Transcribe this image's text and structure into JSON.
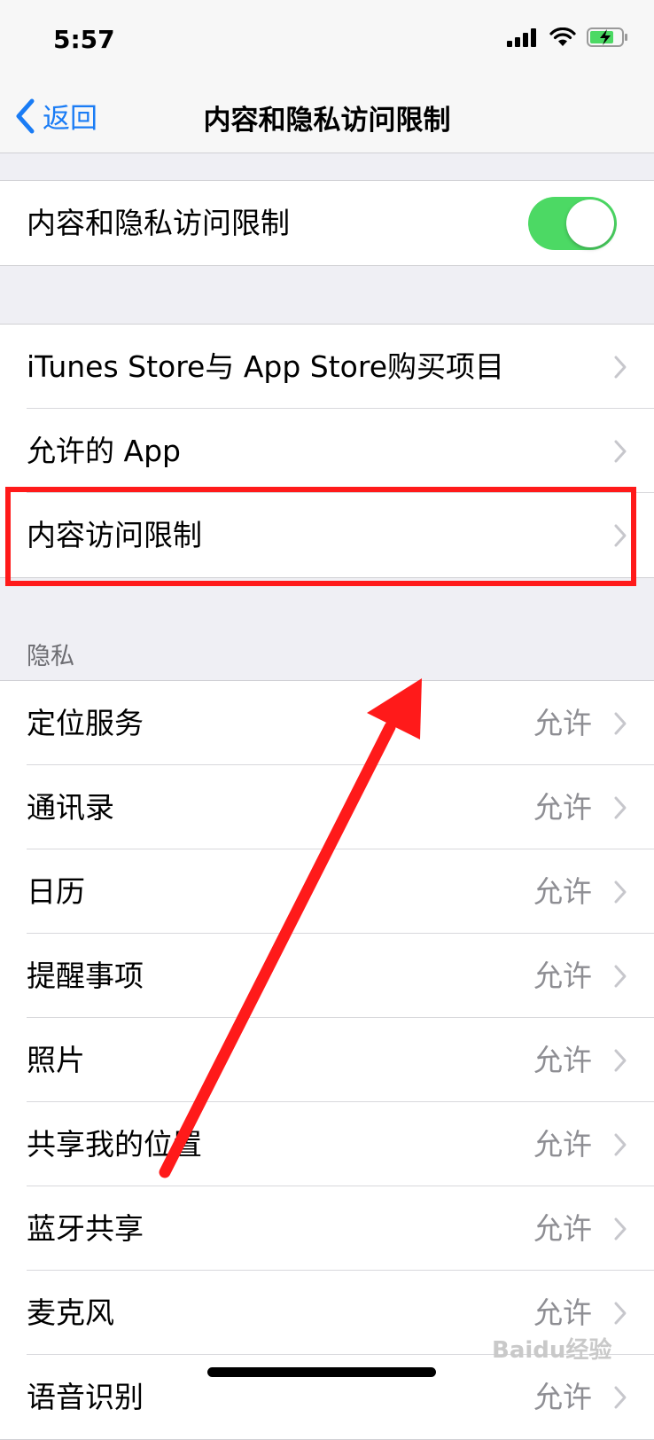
{
  "status_bar": {
    "time": "5:57",
    "icons": [
      "signal-icon",
      "wifi-icon",
      "battery-charging-icon"
    ]
  },
  "nav": {
    "back_label": "返回",
    "title": "内容和隐私访问限制"
  },
  "master_toggle": {
    "label": "内容和隐私访问限制",
    "on": true
  },
  "store_group": [
    {
      "label": "iTunes Store与 App Store购买项目"
    },
    {
      "label": "允许的 App"
    },
    {
      "label": "内容访问限制"
    }
  ],
  "privacy": {
    "header": "隐私",
    "items": [
      {
        "label": "定位服务",
        "value": "允许"
      },
      {
        "label": "通讯录",
        "value": "允许"
      },
      {
        "label": "日历",
        "value": "允许"
      },
      {
        "label": "提醒事项",
        "value": "允许"
      },
      {
        "label": "照片",
        "value": "允许"
      },
      {
        "label": "共享我的位置",
        "value": "允许"
      },
      {
        "label": "蓝牙共享",
        "value": "允许"
      },
      {
        "label": "麦克风",
        "value": "允许"
      },
      {
        "label": "语音识别",
        "value": "允许"
      }
    ]
  },
  "annotation": {
    "highlight_color": "#ff1a1a",
    "highlighted_item": "内容访问限制"
  },
  "colors": {
    "accent": "#1a7cf5",
    "toggle_on": "#4cd964",
    "background": "#efeff4"
  },
  "watermark": "Baidu经验"
}
